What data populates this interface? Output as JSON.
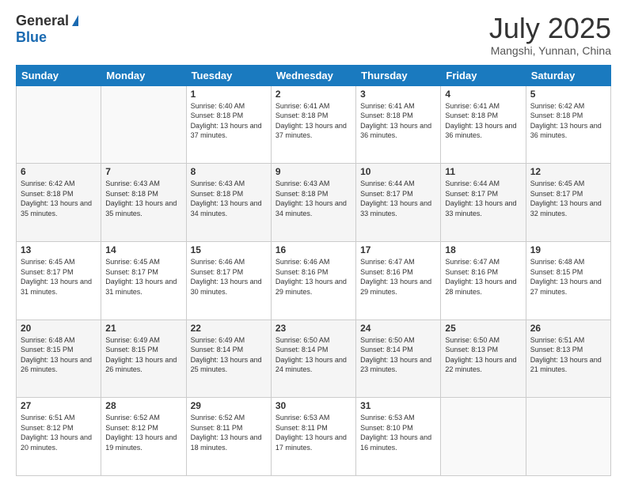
{
  "logo": {
    "general": "General",
    "blue": "Blue"
  },
  "header": {
    "month": "July 2025",
    "location": "Mangshi, Yunnan, China"
  },
  "weekdays": [
    "Sunday",
    "Monday",
    "Tuesday",
    "Wednesday",
    "Thursday",
    "Friday",
    "Saturday"
  ],
  "weeks": [
    [
      {
        "day": "",
        "info": ""
      },
      {
        "day": "",
        "info": ""
      },
      {
        "day": "1",
        "info": "Sunrise: 6:40 AM\nSunset: 8:18 PM\nDaylight: 13 hours and 37 minutes."
      },
      {
        "day": "2",
        "info": "Sunrise: 6:41 AM\nSunset: 8:18 PM\nDaylight: 13 hours and 37 minutes."
      },
      {
        "day": "3",
        "info": "Sunrise: 6:41 AM\nSunset: 8:18 PM\nDaylight: 13 hours and 36 minutes."
      },
      {
        "day": "4",
        "info": "Sunrise: 6:41 AM\nSunset: 8:18 PM\nDaylight: 13 hours and 36 minutes."
      },
      {
        "day": "5",
        "info": "Sunrise: 6:42 AM\nSunset: 8:18 PM\nDaylight: 13 hours and 36 minutes."
      }
    ],
    [
      {
        "day": "6",
        "info": "Sunrise: 6:42 AM\nSunset: 8:18 PM\nDaylight: 13 hours and 35 minutes."
      },
      {
        "day": "7",
        "info": "Sunrise: 6:43 AM\nSunset: 8:18 PM\nDaylight: 13 hours and 35 minutes."
      },
      {
        "day": "8",
        "info": "Sunrise: 6:43 AM\nSunset: 8:18 PM\nDaylight: 13 hours and 34 minutes."
      },
      {
        "day": "9",
        "info": "Sunrise: 6:43 AM\nSunset: 8:18 PM\nDaylight: 13 hours and 34 minutes."
      },
      {
        "day": "10",
        "info": "Sunrise: 6:44 AM\nSunset: 8:17 PM\nDaylight: 13 hours and 33 minutes."
      },
      {
        "day": "11",
        "info": "Sunrise: 6:44 AM\nSunset: 8:17 PM\nDaylight: 13 hours and 33 minutes."
      },
      {
        "day": "12",
        "info": "Sunrise: 6:45 AM\nSunset: 8:17 PM\nDaylight: 13 hours and 32 minutes."
      }
    ],
    [
      {
        "day": "13",
        "info": "Sunrise: 6:45 AM\nSunset: 8:17 PM\nDaylight: 13 hours and 31 minutes."
      },
      {
        "day": "14",
        "info": "Sunrise: 6:45 AM\nSunset: 8:17 PM\nDaylight: 13 hours and 31 minutes."
      },
      {
        "day": "15",
        "info": "Sunrise: 6:46 AM\nSunset: 8:17 PM\nDaylight: 13 hours and 30 minutes."
      },
      {
        "day": "16",
        "info": "Sunrise: 6:46 AM\nSunset: 8:16 PM\nDaylight: 13 hours and 29 minutes."
      },
      {
        "day": "17",
        "info": "Sunrise: 6:47 AM\nSunset: 8:16 PM\nDaylight: 13 hours and 29 minutes."
      },
      {
        "day": "18",
        "info": "Sunrise: 6:47 AM\nSunset: 8:16 PM\nDaylight: 13 hours and 28 minutes."
      },
      {
        "day": "19",
        "info": "Sunrise: 6:48 AM\nSunset: 8:15 PM\nDaylight: 13 hours and 27 minutes."
      }
    ],
    [
      {
        "day": "20",
        "info": "Sunrise: 6:48 AM\nSunset: 8:15 PM\nDaylight: 13 hours and 26 minutes."
      },
      {
        "day": "21",
        "info": "Sunrise: 6:49 AM\nSunset: 8:15 PM\nDaylight: 13 hours and 26 minutes."
      },
      {
        "day": "22",
        "info": "Sunrise: 6:49 AM\nSunset: 8:14 PM\nDaylight: 13 hours and 25 minutes."
      },
      {
        "day": "23",
        "info": "Sunrise: 6:50 AM\nSunset: 8:14 PM\nDaylight: 13 hours and 24 minutes."
      },
      {
        "day": "24",
        "info": "Sunrise: 6:50 AM\nSunset: 8:14 PM\nDaylight: 13 hours and 23 minutes."
      },
      {
        "day": "25",
        "info": "Sunrise: 6:50 AM\nSunset: 8:13 PM\nDaylight: 13 hours and 22 minutes."
      },
      {
        "day": "26",
        "info": "Sunrise: 6:51 AM\nSunset: 8:13 PM\nDaylight: 13 hours and 21 minutes."
      }
    ],
    [
      {
        "day": "27",
        "info": "Sunrise: 6:51 AM\nSunset: 8:12 PM\nDaylight: 13 hours and 20 minutes."
      },
      {
        "day": "28",
        "info": "Sunrise: 6:52 AM\nSunset: 8:12 PM\nDaylight: 13 hours and 19 minutes."
      },
      {
        "day": "29",
        "info": "Sunrise: 6:52 AM\nSunset: 8:11 PM\nDaylight: 13 hours and 18 minutes."
      },
      {
        "day": "30",
        "info": "Sunrise: 6:53 AM\nSunset: 8:11 PM\nDaylight: 13 hours and 17 minutes."
      },
      {
        "day": "31",
        "info": "Sunrise: 6:53 AM\nSunset: 8:10 PM\nDaylight: 13 hours and 16 minutes."
      },
      {
        "day": "",
        "info": ""
      },
      {
        "day": "",
        "info": ""
      }
    ]
  ]
}
